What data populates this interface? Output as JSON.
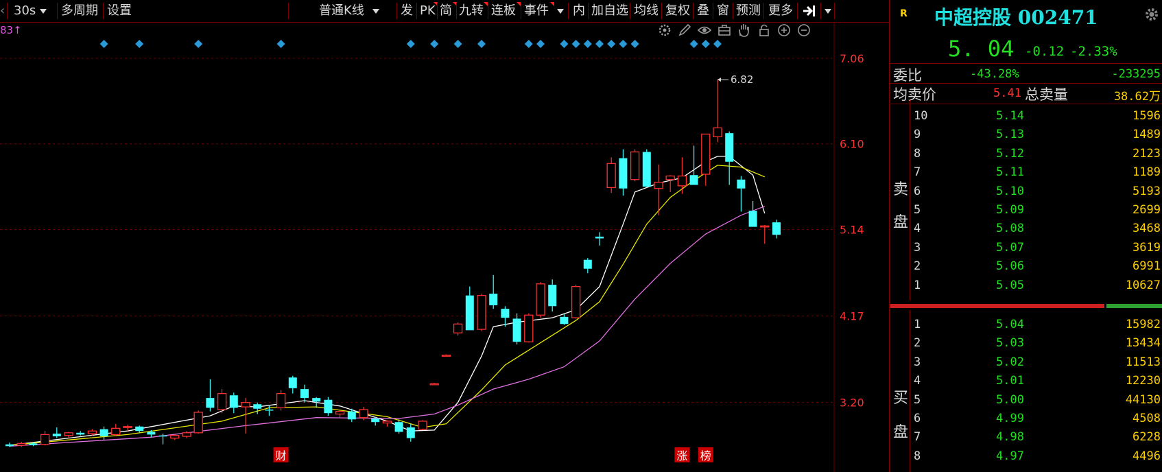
{
  "toolbar": {
    "period": "30s",
    "multi_period": "多周期",
    "settings": "设置",
    "kline_type": "普通K线",
    "buttons": [
      "发",
      "PK",
      "简",
      "九转",
      "连板",
      "事件"
    ],
    "buttons2": [
      "内",
      "加自选",
      "均线",
      "复权",
      "叠",
      "窗",
      "预测",
      "更多"
    ]
  },
  "chart_tools": [
    "gear-icon",
    "pen-icon",
    "eye-icon",
    "briefcase-icon",
    "hand-icon",
    "lock-icon",
    "zoom-in-icon",
    "zoom-out-icon"
  ],
  "chart_tools_color": "#9a9a9a",
  "chart_data": {
    "type": "candlestick",
    "price_ticks": [
      "7.06",
      "6.10",
      "5.14",
      "4.17",
      "3.20"
    ],
    "ylim": [
      2.42,
      7.46
    ],
    "top_left_label": "83↑",
    "max_annotation": "6.82",
    "event_markers": [
      {
        "label": "财",
        "index": 23
      },
      {
        "label": "涨",
        "index": 57
      },
      {
        "label": "榜",
        "index": 59
      }
    ],
    "diamond_indices": [
      8,
      11,
      16,
      23,
      34,
      36,
      38,
      40,
      44,
      45,
      47,
      48,
      49,
      50,
      51,
      52,
      53,
      58,
      59,
      60
    ],
    "candles": [
      [
        2.73,
        2.75,
        2.7,
        2.71
      ],
      [
        2.72,
        2.76,
        2.7,
        2.74
      ],
      [
        2.74,
        2.75,
        2.71,
        2.72
      ],
      [
        2.73,
        2.88,
        2.72,
        2.84
      ],
      [
        2.85,
        2.92,
        2.8,
        2.82
      ],
      [
        2.83,
        2.87,
        2.8,
        2.86
      ],
      [
        2.86,
        2.88,
        2.83,
        2.84
      ],
      [
        2.85,
        2.9,
        2.83,
        2.88
      ],
      [
        2.9,
        2.93,
        2.78,
        2.82
      ],
      [
        2.84,
        2.96,
        2.82,
        2.91
      ],
      [
        2.92,
        2.95,
        2.88,
        2.93
      ],
      [
        2.93,
        2.94,
        2.86,
        2.88
      ],
      [
        2.87,
        2.89,
        2.81,
        2.84
      ],
      [
        2.83,
        2.85,
        2.73,
        2.82
      ],
      [
        2.8,
        2.84,
        2.78,
        2.83
      ],
      [
        2.82,
        2.88,
        2.8,
        2.86
      ],
      [
        2.86,
        3.11,
        2.85,
        3.09
      ],
      [
        3.25,
        3.46,
        3.1,
        3.14
      ],
      [
        3.12,
        3.35,
        3.08,
        3.3
      ],
      [
        3.28,
        3.31,
        3.08,
        3.14
      ],
      [
        3.15,
        3.25,
        2.85,
        3.2
      ],
      [
        3.18,
        3.2,
        3.07,
        3.13
      ],
      [
        3.12,
        3.16,
        3.05,
        3.11
      ],
      [
        3.14,
        3.34,
        3.11,
        3.3
      ],
      [
        3.48,
        3.5,
        3.3,
        3.36
      ],
      [
        3.35,
        3.4,
        3.2,
        3.25
      ],
      [
        3.25,
        3.26,
        3.14,
        3.21
      ],
      [
        3.23,
        3.26,
        3.05,
        3.08
      ],
      [
        3.07,
        3.11,
        3.03,
        3.1
      ],
      [
        3.1,
        3.13,
        2.98,
        3.01
      ],
      [
        3.03,
        3.15,
        3.0,
        3.12
      ],
      [
        3.02,
        3.04,
        2.94,
        2.98
      ],
      [
        2.97,
        3.0,
        2.93,
        2.99
      ],
      [
        2.98,
        3.01,
        2.85,
        2.87
      ],
      [
        2.92,
        2.96,
        2.76,
        2.8
      ],
      [
        2.9,
        3.0,
        2.89,
        2.99
      ],
      [
        3.41,
        3.42,
        3.4,
        3.41
      ],
      [
        3.73,
        3.74,
        3.72,
        3.73
      ],
      [
        3.98,
        4.1,
        3.95,
        4.08
      ],
      [
        4.4,
        4.5,
        4.05,
        4.01
      ],
      [
        4.02,
        4.42,
        4.0,
        4.4
      ],
      [
        4.42,
        4.63,
        4.25,
        4.29
      ],
      [
        4.25,
        4.28,
        4.05,
        4.15
      ],
      [
        4.14,
        4.2,
        3.85,
        3.88
      ],
      [
        3.88,
        4.2,
        3.87,
        4.18
      ],
      [
        4.18,
        4.55,
        4.15,
        4.53
      ],
      [
        4.52,
        4.58,
        4.22,
        4.28
      ],
      [
        4.16,
        4.19,
        4.07,
        4.08
      ],
      [
        4.15,
        4.52,
        4.14,
        4.5
      ],
      [
        4.8,
        4.82,
        4.65,
        4.7
      ],
      [
        5.06,
        5.11,
        4.96,
        5.04
      ],
      [
        5.61,
        5.95,
        5.55,
        5.88
      ],
      [
        5.94,
        6.04,
        5.52,
        5.6
      ],
      [
        5.7,
        6.04,
        5.68,
        6.01
      ],
      [
        6.01,
        6.04,
        5.65,
        5.62
      ],
      [
        5.6,
        5.87,
        5.3,
        5.67
      ],
      [
        5.7,
        5.75,
        5.56,
        5.74
      ],
      [
        5.63,
        5.95,
        5.54,
        5.74
      ],
      [
        5.75,
        6.08,
        5.71,
        5.64
      ],
      [
        5.76,
        6.21,
        5.63,
        6.21
      ],
      [
        6.18,
        6.82,
        6.12,
        6.28
      ],
      [
        6.22,
        6.24,
        5.64,
        5.9
      ],
      [
        5.7,
        5.74,
        5.34,
        5.6
      ],
      [
        5.35,
        5.46,
        5.24,
        5.17
      ],
      [
        5.17,
        5.19,
        4.98,
        5.18
      ],
      [
        5.22,
        5.25,
        5.04,
        5.08
      ]
    ],
    "ma_series": [
      {
        "color": "#ffffff",
        "points": [
          [
            0,
            2.72
          ],
          [
            10,
            2.88
          ],
          [
            17,
            3.05
          ],
          [
            19,
            3.16
          ],
          [
            21,
            3.15
          ],
          [
            25,
            3.22
          ],
          [
            28,
            3.16
          ],
          [
            32,
            2.99
          ],
          [
            34,
            2.88
          ],
          [
            36,
            2.89
          ],
          [
            38,
            3.2
          ],
          [
            40,
            3.72
          ],
          [
            41,
            4.05
          ],
          [
            43,
            4.1
          ],
          [
            46,
            4.15
          ],
          [
            48,
            4.24
          ],
          [
            50,
            4.5
          ],
          [
            52,
            5.2
          ],
          [
            53,
            5.56
          ],
          [
            55,
            5.66
          ],
          [
            57,
            5.72
          ],
          [
            59,
            5.9
          ],
          [
            60,
            5.96
          ],
          [
            61,
            5.96
          ],
          [
            63,
            5.75
          ],
          [
            64,
            5.32
          ]
        ]
      },
      {
        "color": "#e8e800",
        "points": [
          [
            0,
            2.72
          ],
          [
            10,
            2.84
          ],
          [
            18,
            2.99
          ],
          [
            22,
            3.14
          ],
          [
            26,
            3.15
          ],
          [
            32,
            3.04
          ],
          [
            35,
            2.92
          ],
          [
            37,
            2.96
          ],
          [
            40,
            3.34
          ],
          [
            42,
            3.62
          ],
          [
            45,
            3.87
          ],
          [
            48,
            4.12
          ],
          [
            50,
            4.33
          ],
          [
            52,
            4.75
          ],
          [
            54,
            5.2
          ],
          [
            56,
            5.5
          ],
          [
            58,
            5.69
          ],
          [
            60,
            5.86
          ],
          [
            62,
            5.84
          ],
          [
            64,
            5.73
          ]
        ]
      },
      {
        "color": "#e070e0",
        "points": [
          [
            0,
            2.71
          ],
          [
            12,
            2.81
          ],
          [
            20,
            2.94
          ],
          [
            26,
            3.03
          ],
          [
            33,
            3.02
          ],
          [
            36,
            3.07
          ],
          [
            38,
            3.17
          ],
          [
            41,
            3.35
          ],
          [
            44,
            3.46
          ],
          [
            47,
            3.6
          ],
          [
            50,
            3.89
          ],
          [
            53,
            4.36
          ],
          [
            56,
            4.76
          ],
          [
            59,
            5.09
          ],
          [
            62,
            5.3
          ],
          [
            64,
            5.4
          ]
        ]
      }
    ],
    "up_color": "#ff3030",
    "down_color": "#40ffff",
    "grid_color": "#6e0000"
  },
  "panel": {
    "r_badge": "R",
    "name": "中超控股",
    "code": "002471",
    "price": "5. 04",
    "change": "-0.12",
    "change_pct": "-2.33%",
    "weibi_label": "委比",
    "weibi_pct": "-43.28%",
    "weibi_val": "-233295",
    "avg_sell_label": "均卖价",
    "avg_sell_price": "5.41",
    "total_sell_label": "总卖量",
    "total_sell_val": "38.62万",
    "sell_label_1": "卖",
    "sell_label_2": "盘",
    "buy_label_1": "买",
    "buy_label_2": "盘",
    "sell_levels": [
      {
        "level": "10",
        "price": "5.14",
        "vol": "1596"
      },
      {
        "level": "9",
        "price": "5.13",
        "vol": "1489"
      },
      {
        "level": "8",
        "price": "5.12",
        "vol": "2123"
      },
      {
        "level": "7",
        "price": "5.11",
        "vol": "1189"
      },
      {
        "level": "6",
        "price": "5.10",
        "vol": "5193"
      },
      {
        "level": "5",
        "price": "5.09",
        "vol": "2699"
      },
      {
        "level": "4",
        "price": "5.08",
        "vol": "3468"
      },
      {
        "level": "3",
        "price": "5.07",
        "vol": "3619"
      },
      {
        "level": "2",
        "price": "5.06",
        "vol": "6991"
      },
      {
        "level": "1",
        "price": "5.05",
        "vol": "10627"
      }
    ],
    "buy_levels": [
      {
        "level": "1",
        "price": "5.04",
        "vol": "15982"
      },
      {
        "level": "2",
        "price": "5.03",
        "vol": "13434"
      },
      {
        "level": "3",
        "price": "5.02",
        "vol": "11513"
      },
      {
        "level": "4",
        "price": "5.01",
        "vol": "12230"
      },
      {
        "level": "5",
        "price": "5.00",
        "vol": "44130"
      },
      {
        "level": "6",
        "price": "4.99",
        "vol": "4508"
      },
      {
        "level": "7",
        "price": "4.98",
        "vol": "6228"
      },
      {
        "level": "8",
        "price": "4.97",
        "vol": "4496"
      }
    ],
    "bar_ratio": 0.785
  }
}
